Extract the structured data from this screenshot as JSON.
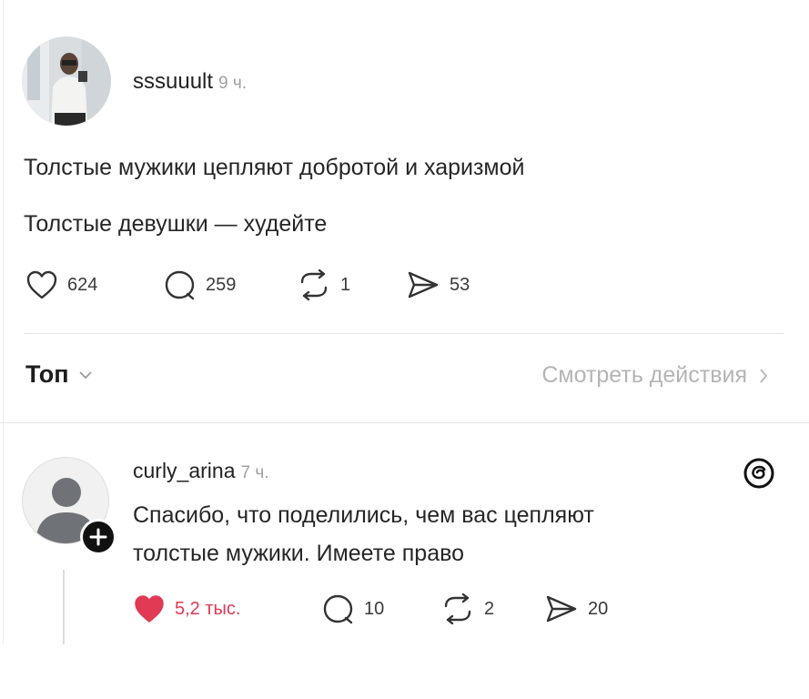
{
  "post": {
    "username": "sssuuult",
    "time": "9 ч.",
    "lines": [
      "Толстые мужики цепляют добротой и харизмой",
      "Толстые девушки — худейте"
    ],
    "actions": {
      "likes": "624",
      "comments": "259",
      "reposts": "1",
      "shares": "53"
    }
  },
  "sort": {
    "label": "Топ"
  },
  "view_activity": {
    "label": "Смотреть действия"
  },
  "reply": {
    "username": "curly_arina",
    "time": "7 ч.",
    "lines": [
      "Спасибо, что поделились, чем вас цепляют",
      "толстые мужики. Имеете право"
    ],
    "actions": {
      "likes": "5,2 тыс.",
      "comments": "10",
      "reposts": "2",
      "shares": "20"
    }
  },
  "colors": {
    "like_active": "#e03a54",
    "text": "#262626",
    "muted": "#a0a0a0"
  },
  "icons": [
    "heart-icon",
    "comment-icon",
    "repost-icon",
    "share-icon",
    "chevron-down-icon",
    "chevron-right-icon",
    "threads-logo-icon",
    "plus-icon"
  ]
}
